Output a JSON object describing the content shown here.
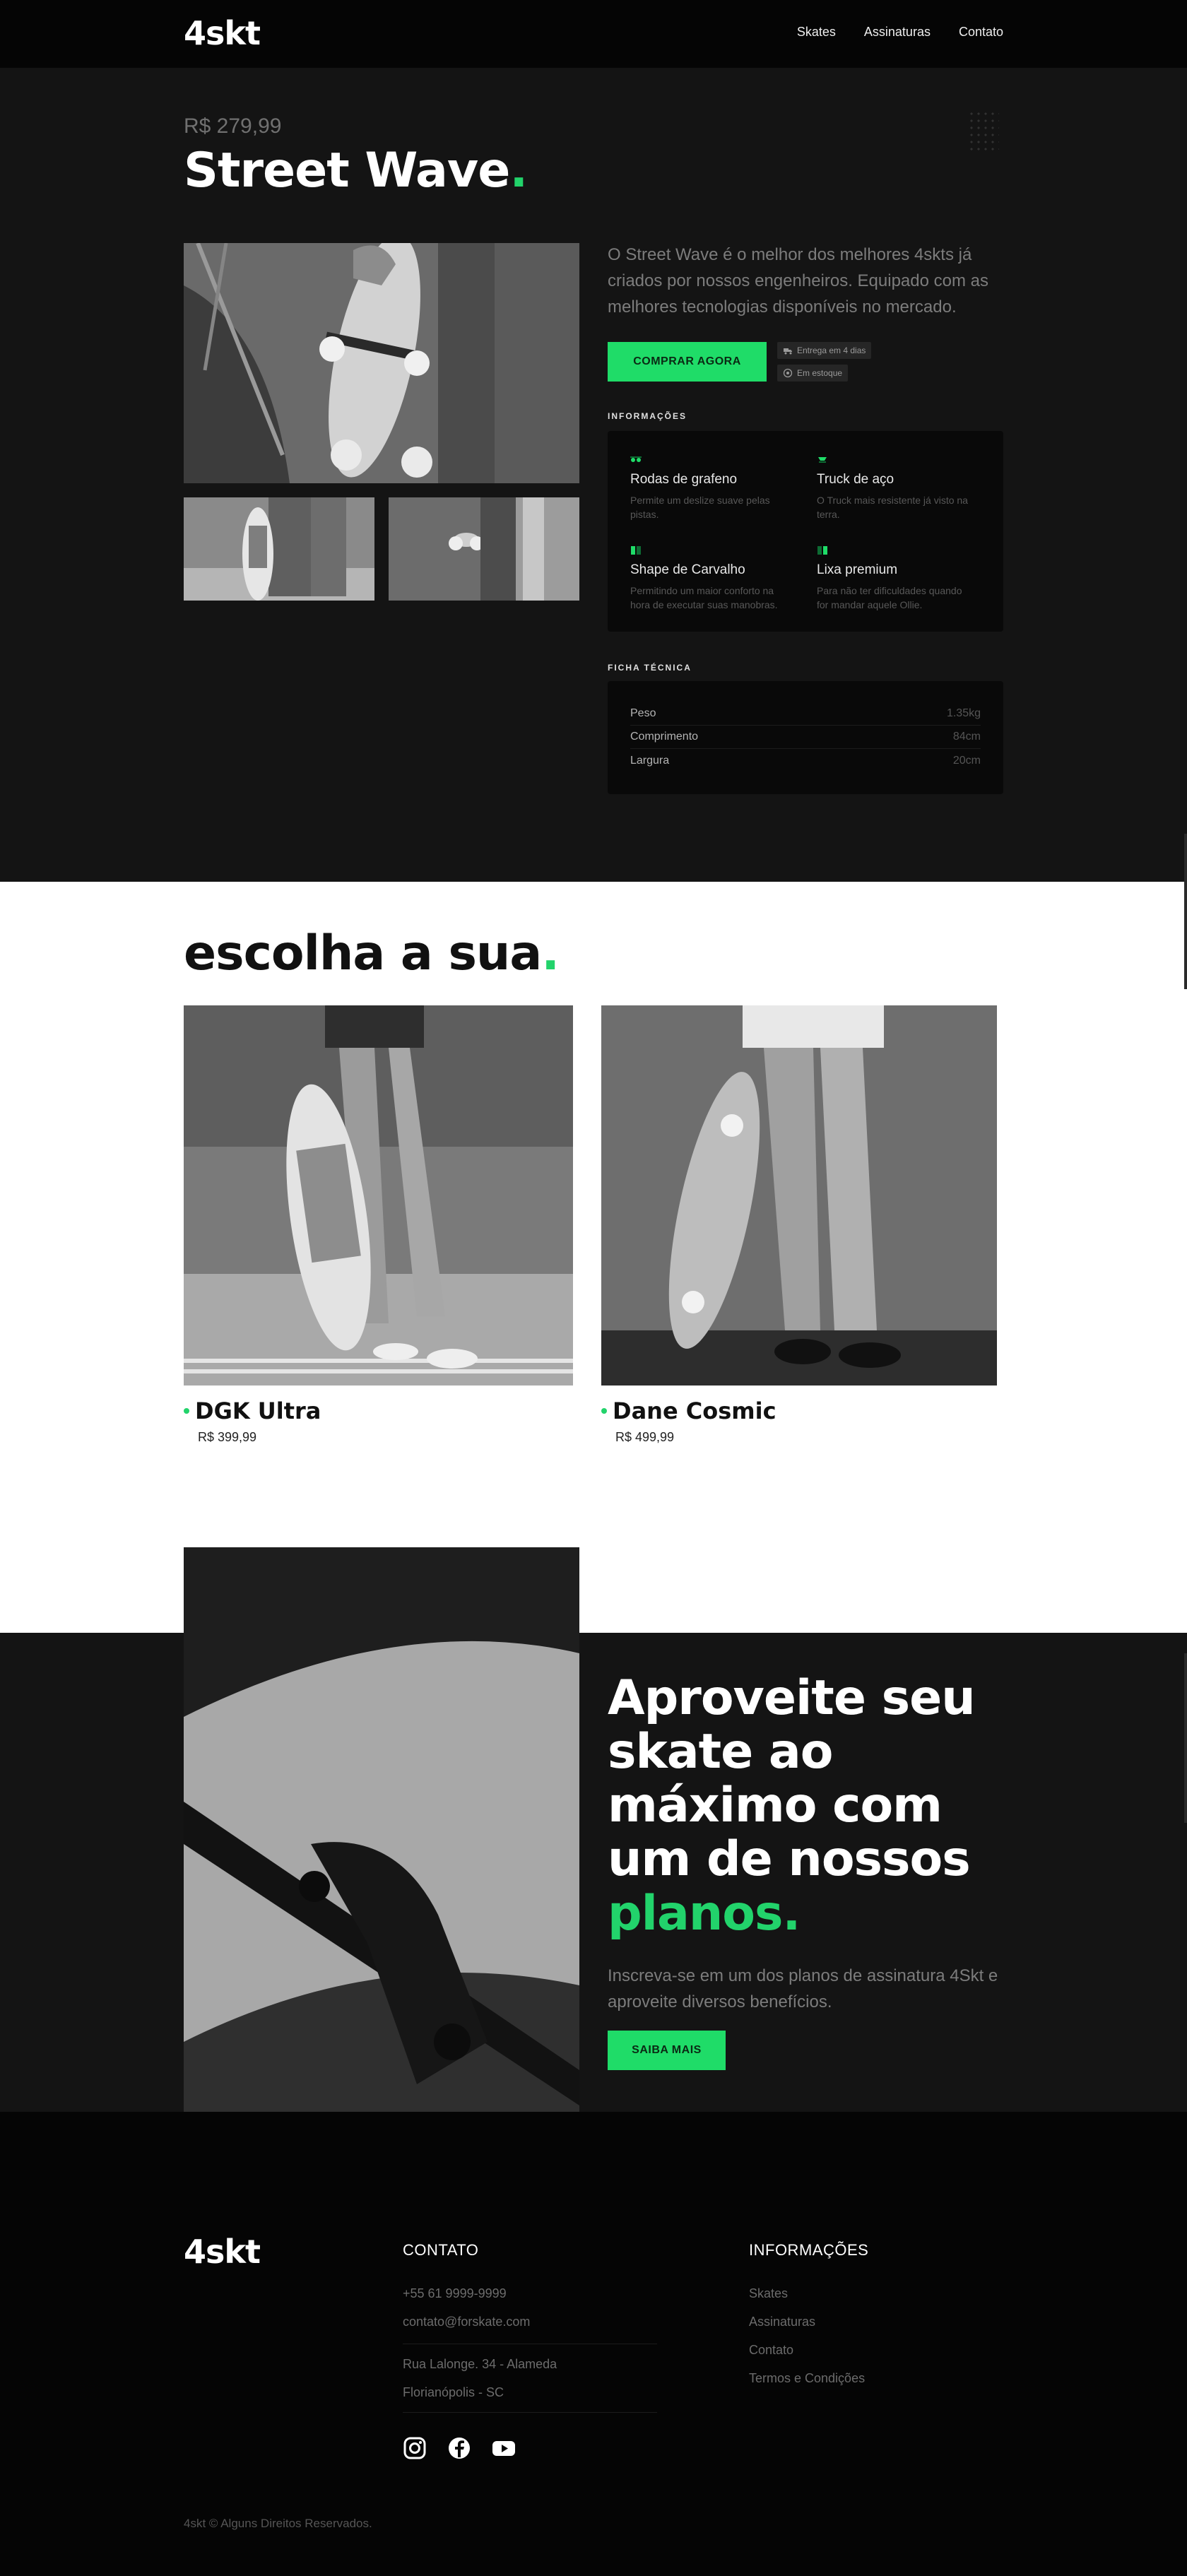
{
  "header": {
    "logo": "4skt",
    "nav": [
      "Skates",
      "Assinaturas",
      "Contato"
    ]
  },
  "product": {
    "price": "R$ 279,99",
    "title": "Street Wave",
    "title_dot": ".",
    "description": "O Street Wave é o melhor dos melhores 4skts já criados por nossos engenheiros. Equipado com as melhores tecnologias disponíveis no mercado.",
    "buy_label": "COMPRAR AGORA",
    "badges": [
      {
        "icon": "truck-icon",
        "text": "Entrega em 4 dias"
      },
      {
        "icon": "box-icon",
        "text": "Em estoque"
      }
    ],
    "info_heading": "INFORMAÇÕES",
    "features": [
      {
        "icon": "wheels-icon",
        "title": "Rodas de grafeno",
        "text": "Permite um deslize suave pelas pistas."
      },
      {
        "icon": "truck-axle-icon",
        "title": "Truck de aço",
        "text": "O Truck mais resistente já visto na terra."
      },
      {
        "icon": "deck-icon",
        "title": "Shape de Carvalho",
        "text": "Permitindo um maior conforto na hora de executar suas manobras."
      },
      {
        "icon": "grip-icon",
        "title": "Lixa premium",
        "text": "Para não ter dificuldades quando for mandar aquele Ollie."
      }
    ],
    "spec_heading": "FICHA TÉCNICA",
    "specs": [
      {
        "label": "Peso",
        "value": "1.35kg"
      },
      {
        "label": "Comprimento",
        "value": "84cm"
      },
      {
        "label": "Largura",
        "value": "20cm"
      }
    ]
  },
  "choose": {
    "title": "escolha a sua",
    "title_dot": ".",
    "products": [
      {
        "name": "DGK Ultra",
        "price": "R$ 399,99"
      },
      {
        "name": "Dane Cosmic",
        "price": "R$ 499,99"
      }
    ]
  },
  "plans": {
    "headline": "Aproveite seu skate ao máximo com um de nossos",
    "highlight": "planos.",
    "text": "Inscreva-se em um dos planos de assinatura 4Skt e aproveite diversos benefícios.",
    "button": "SAIBA MAIS"
  },
  "footer": {
    "logo": "4skt",
    "contact_heading": "CONTATO",
    "phone": "+55 61 9999-9999",
    "email": "contato@forskate.com",
    "address1": "Rua Lalonge. 34 - Alameda",
    "address2": "Florianópolis - SC",
    "social": [
      "instagram-icon",
      "facebook-icon",
      "youtube-icon"
    ],
    "info_heading": "INFORMAÇÕES",
    "links": [
      "Skates",
      "Assinaturas",
      "Contato",
      "Termos e Condições"
    ],
    "copyright": "4skt © Alguns Direitos Reservados."
  },
  "colors": {
    "accent": "#1fdc68",
    "dark": "#141414",
    "darker": "#050505",
    "white": "#ffffff"
  }
}
